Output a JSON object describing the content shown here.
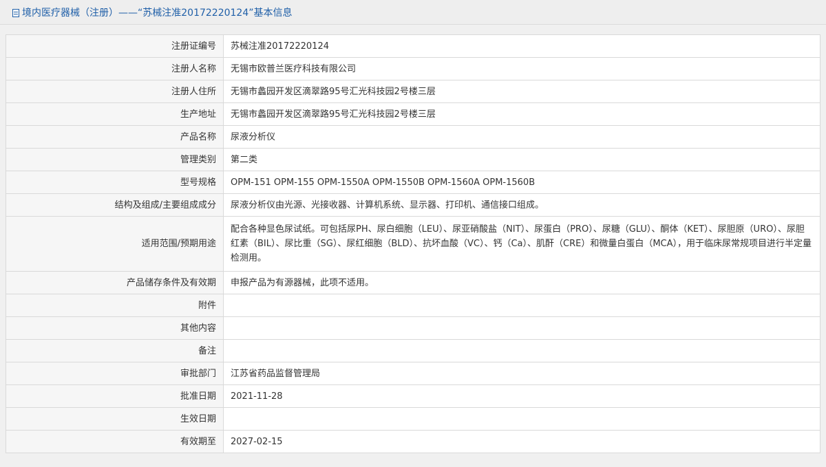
{
  "header": {
    "title": "境内医疗器械（注册）——“苏械注准20172220124”基本信息",
    "icon": "document-icon"
  },
  "rows": [
    {
      "label": "注册证编号",
      "value": "苏械注准20172220124"
    },
    {
      "label": "注册人名称",
      "value": "无锡市欧普兰医疗科技有限公司"
    },
    {
      "label": "注册人住所",
      "value": "无锡市蠡园开发区滴翠路95号汇光科技园2号楼三层"
    },
    {
      "label": "生产地址",
      "value": "无锡市蠡园开发区滴翠路95号汇光科技园2号楼三层"
    },
    {
      "label": "产品名称",
      "value": "尿液分析仪"
    },
    {
      "label": "管理类别",
      "value": "第二类"
    },
    {
      "label": "型号规格",
      "value": "OPM-151 OPM-155 OPM-1550A OPM-1550B OPM-1560A OPM-1560B"
    },
    {
      "label": "结构及组成/主要组成成分",
      "value": "尿液分析仪由光源、光接收器、计算机系统、显示器、打印机、通信接口组成。"
    },
    {
      "label": "适用范围/预期用途",
      "value": "配合各种显色尿试纸。可包括尿PH、尿白细胞（LEU）、尿亚硝酸盐（NIT）、尿蛋白（PRO）、尿糖（GLU）、酮体（KET）、尿胆原（URO）、尿胆红素（BIL）、尿比重（SG）、尿红细胞（BLD）、抗坏血酸（VC）、钙（Ca）、肌酐（CRE）和微量白蛋白（MCA），用于临床尿常规项目进行半定量检测用。"
    },
    {
      "label": "产品储存条件及有效期",
      "value": "申报产品为有源器械，此项不适用。"
    },
    {
      "label": "附件",
      "value": ""
    },
    {
      "label": "其他内容",
      "value": ""
    },
    {
      "label": "备注",
      "value": ""
    },
    {
      "label": "审批部门",
      "value": "江苏省药品监督管理局"
    },
    {
      "label": "批准日期",
      "value": "2021-11-28"
    },
    {
      "label": "生效日期",
      "value": ""
    },
    {
      "label": "有效期至",
      "value": "2027-02-15"
    }
  ]
}
